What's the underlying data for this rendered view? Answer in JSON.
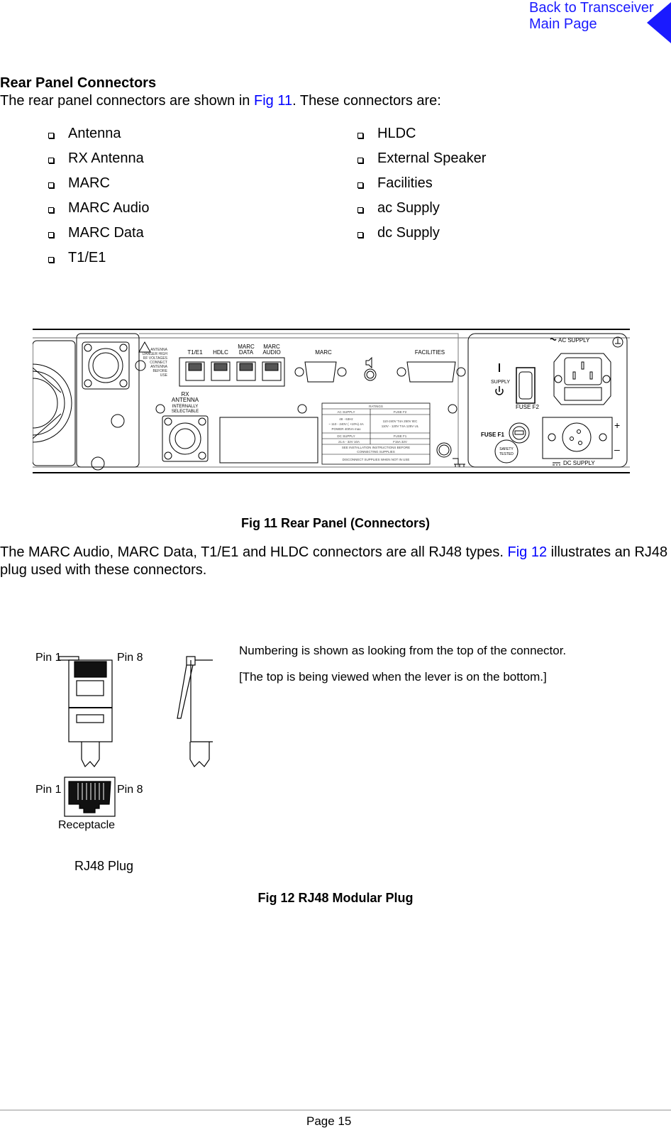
{
  "nav": {
    "back_link_line1": "Back to Transceiver",
    "back_link_line2": "Main Page",
    "back_icon": "triangle-left-icon",
    "link_color": "#1a1aff"
  },
  "section": {
    "title": "Rear Panel Connectors",
    "intro_before": "The rear panel connectors are shown in ",
    "intro_link": "Fig 11",
    "intro_after": ". These connectors are:"
  },
  "connector_list": {
    "bullet_icon": "square-bullet-icon",
    "left": [
      "Antenna",
      "RX Antenna",
      "MARC",
      "MARC Audio",
      "MARC Data",
      "T1/E1"
    ],
    "right": [
      "HLDC",
      "External Speaker",
      "Facilities",
      "ac Supply",
      "dc Supply"
    ]
  },
  "fig11": {
    "caption": "Fig 11  Rear Panel (Connectors)",
    "panel_labels": {
      "antenna_warning": [
        "ANTENNA",
        "DANGER HIGH",
        "RF VOLTAGES",
        "CONNECT",
        "ANTENNA",
        "BEFORE",
        "USE"
      ],
      "t1e1": "T1/E1",
      "hdlc": "HDLC",
      "marc_data": [
        "MARC",
        "DATA"
      ],
      "marc_audio": [
        "MARC",
        "AUDIO"
      ],
      "marc": "MARC",
      "facilities": "FACILITIES",
      "rx_antenna": [
        "RX",
        "ANTENNA"
      ],
      "internally_selectable": [
        "INTERNALLY",
        "SELECTABLE"
      ],
      "supply": "SUPPLY",
      "ac_supply": "AC SUPPLY",
      "fuse_f2": "FUSE F2",
      "fuse_f1": "FUSE F1",
      "safety_tested": [
        "SAFETY",
        "TESTED"
      ],
      "dc_supply": "DC SUPPLY",
      "plus": "+",
      "minus": "–"
    },
    "ratings_table": {
      "title": "RATINGS",
      "ac_header": "AC SUPPLY",
      "fuse_f2_header": "FUSE F2",
      "ac_values": [
        "48 - 63Hz",
        "~ 110 - 240V ( +10%) 4A",
        "POWER 400VA max"
      ],
      "fuse_f2_values": [
        "110-240V T4A 250V IEC",
        "110V - 120V T4A 125V UL"
      ],
      "dc_header": "DC SUPPLY",
      "fuse_f1_header": "FUSE F1",
      "dc_value": "21.6 - 32V 10A",
      "fuse_f1_value": "F15A 32V",
      "notice1": [
        "SEE INSTALLATION INSTRUCTIONS BEFORE",
        "CONNECTING SUPPLIES"
      ],
      "notice2": "DISCONNECT SUPPLIES WHEN NOT IN USE"
    }
  },
  "para2": {
    "before": "The MARC Audio, MARC Data, T1/E1 and HLDC connectors are all RJ48 types. ",
    "link": "Fig 12",
    "after": " illustrates an RJ48 plug used with these connectors."
  },
  "fig12": {
    "pin1": "Pin 1",
    "pin8": "Pin 8",
    "receptacle": "Receptacle",
    "plug_label": "RJ48 Plug",
    "note1": "Numbering is shown as looking from the top of the connector.",
    "note2": "[The top is being viewed when the lever is on the bottom.]",
    "caption": "Fig 12  RJ48 Modular Plug"
  },
  "footer": {
    "page": "Page 15"
  }
}
